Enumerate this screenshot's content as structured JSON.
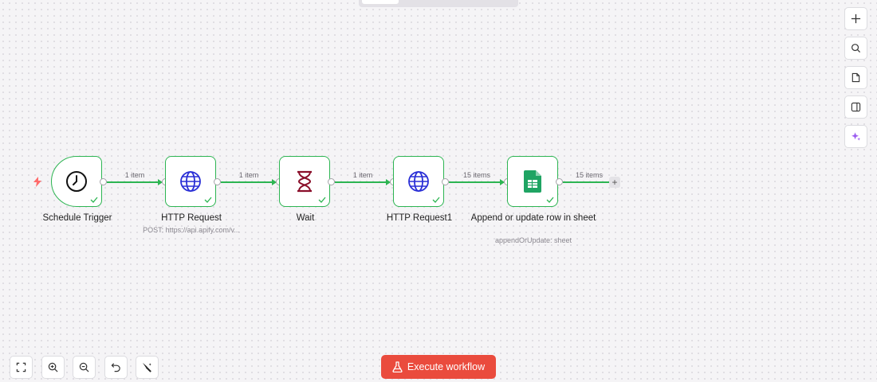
{
  "canvas": {
    "nodes": [
      {
        "title": "Schedule Trigger",
        "subtitle": "",
        "icon": "clock-icon"
      },
      {
        "title": "HTTP Request",
        "subtitle": "POST: https://api.apify.com/v...",
        "icon": "globe-icon"
      },
      {
        "title": "Wait",
        "subtitle": "",
        "icon": "hourglass-icon"
      },
      {
        "title": "HTTP Request1",
        "subtitle": "",
        "icon": "globe-icon"
      },
      {
        "title": "Append or update row in sheet",
        "subtitle": "appendOrUpdate: sheet",
        "icon": "google-sheets-icon"
      }
    ],
    "edges": [
      {
        "label": "1 item"
      },
      {
        "label": "1 item"
      },
      {
        "label": "1 item"
      },
      {
        "label": "15 items"
      },
      {
        "label": "15 items"
      }
    ],
    "add_node_label": "+"
  },
  "right_toolbar": {
    "icons": [
      "plus-icon",
      "search-icon",
      "sticky-note-icon",
      "panel-icon",
      "sparkle-icon"
    ]
  },
  "bottom_toolbar": {
    "icons": [
      "fit-view-icon",
      "zoom-in-icon",
      "zoom-out-icon",
      "undo-icon",
      "tidy-up-icon"
    ]
  },
  "execute_button": {
    "label": "Execute workflow",
    "icon": "flask-icon"
  },
  "colors": {
    "success": "#2db552",
    "execute": "#ea4b3d",
    "globe": "#2a2fd6",
    "hourglass": "#8a0f2a",
    "sheets": "#1fa463",
    "sparkle": "#9b5cf0",
    "trigger_bolt": "#ff6b6b"
  }
}
